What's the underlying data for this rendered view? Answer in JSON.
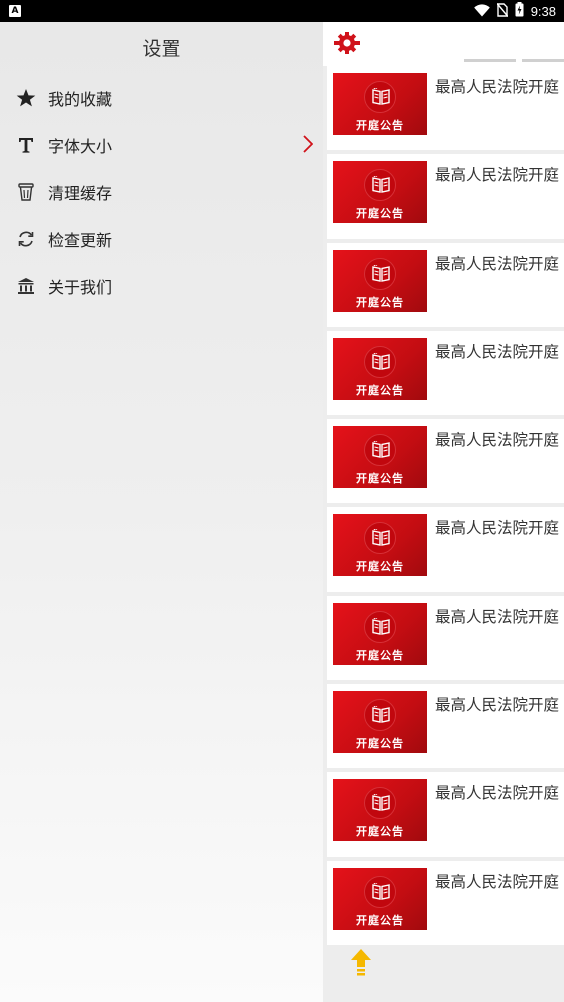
{
  "status_bar": {
    "left_badge": "A",
    "time": "9:38",
    "icons": [
      "wifi-icon",
      "no-sim-icon",
      "battery-icon"
    ]
  },
  "drawer": {
    "title": "设置",
    "items": [
      {
        "label": "我的收藏",
        "icon": "star-icon"
      },
      {
        "label": "字体大小",
        "icon": "font-size-icon"
      },
      {
        "label": "清理缓存",
        "icon": "trash-icon"
      },
      {
        "label": "检查更新",
        "icon": "refresh-icon"
      },
      {
        "label": "关于我们",
        "icon": "building-icon"
      }
    ]
  },
  "main": {
    "gear_icon": "gear-icon",
    "news": [
      {
        "title": "最高人民法院开庭",
        "thumb_label": "开庭公告"
      },
      {
        "title": "最高人民法院开庭",
        "thumb_label": "开庭公告"
      },
      {
        "title": "最高人民法院开庭",
        "thumb_label": "开庭公告"
      },
      {
        "title": "最高人民法院开庭",
        "thumb_label": "开庭公告"
      },
      {
        "title": "最高人民法院开庭",
        "thumb_label": "开庭公告"
      },
      {
        "title": "最高人民法院开庭",
        "thumb_label": "开庭公告"
      },
      {
        "title": "最高人民法院开庭",
        "thumb_label": "开庭公告"
      },
      {
        "title": "最高人民法院开庭",
        "thumb_label": "开庭公告"
      },
      {
        "title": "最高人民法院开庭",
        "thumb_label": "开庭公告"
      },
      {
        "title": "最高人民法院开庭",
        "thumb_label": "开庭公告"
      }
    ]
  },
  "colors": {
    "accent_red": "#d0121a",
    "fab_yellow": "#f5b800"
  }
}
